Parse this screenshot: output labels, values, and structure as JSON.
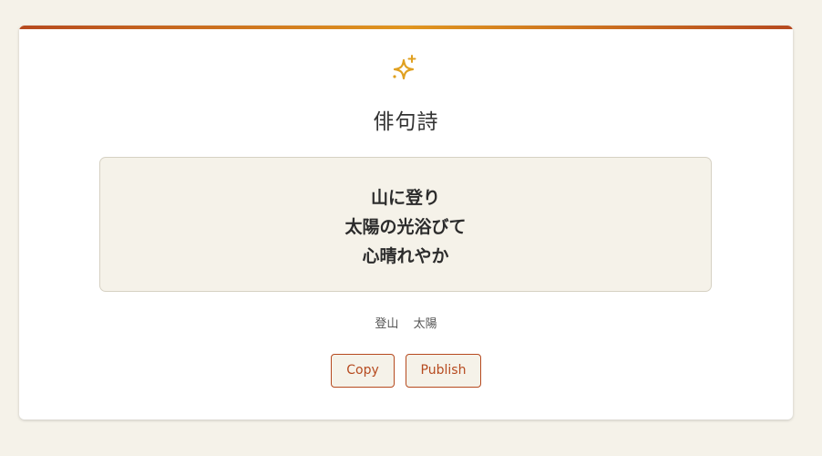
{
  "colors": {
    "accent": "#b64a1f",
    "sparkle": "#e0a020",
    "background": "#f5f2e9"
  },
  "header": {
    "icon": "sparkle-icon",
    "title": "俳句詩"
  },
  "poem": {
    "lines": [
      "山に登り",
      "太陽の光浴びて",
      "心晴れやか"
    ]
  },
  "tags": [
    "登山",
    "太陽"
  ],
  "actions": {
    "copy_label": "Copy",
    "publish_label": "Publish"
  }
}
